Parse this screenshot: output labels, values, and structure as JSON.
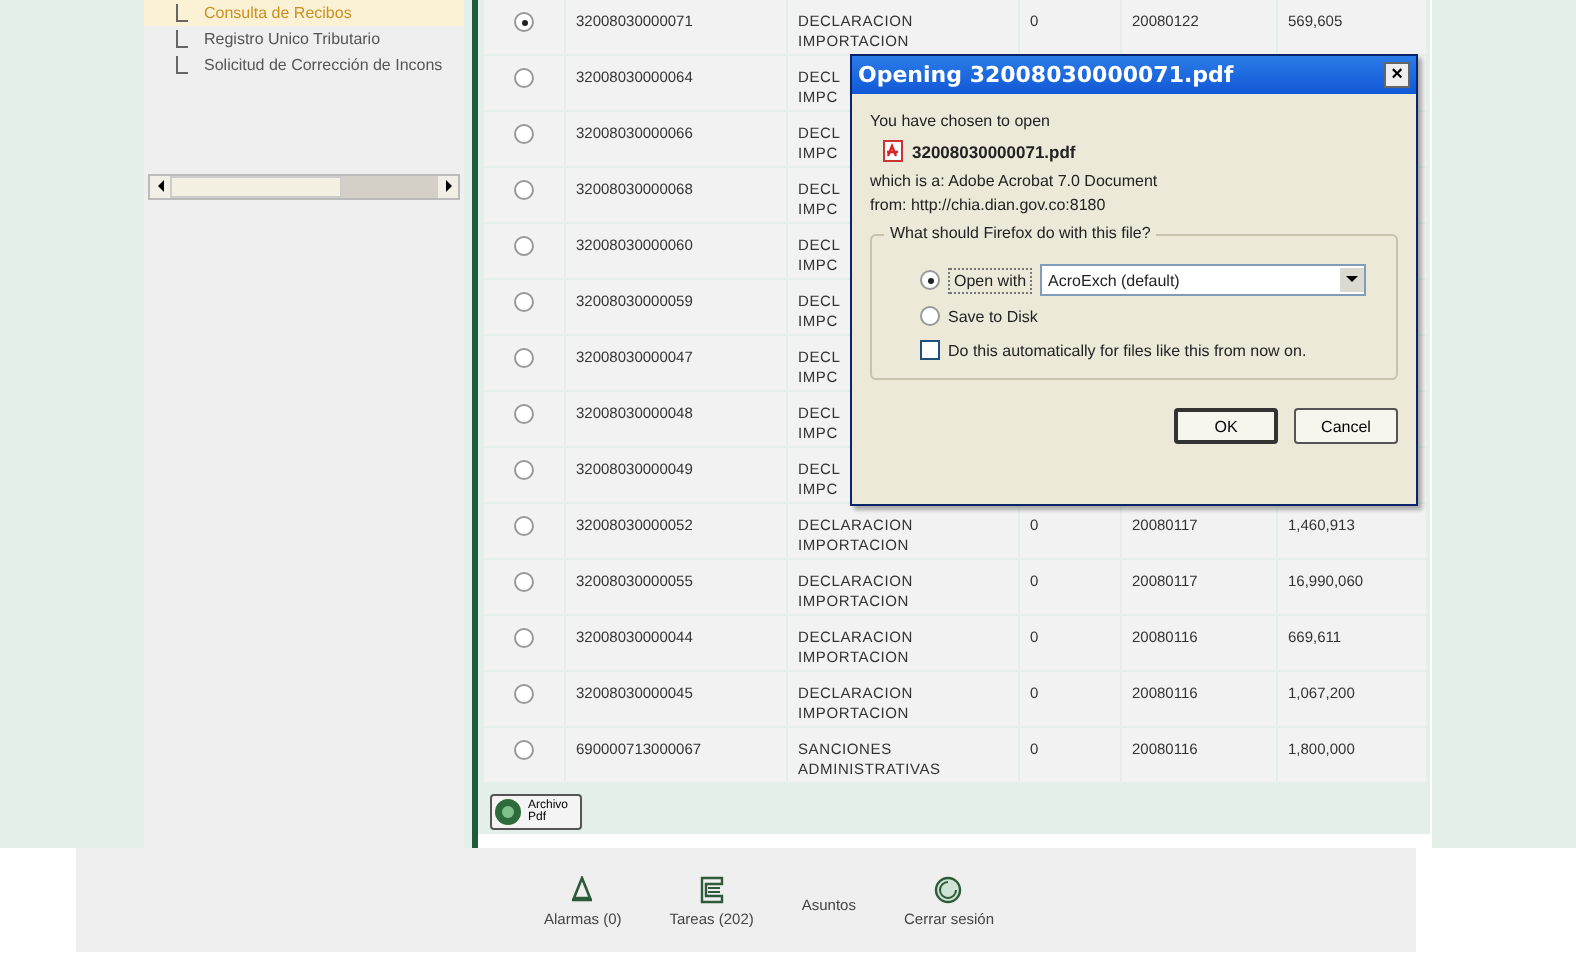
{
  "sidebar": {
    "items": [
      {
        "label": "Consulta de Recibos",
        "selected": true
      },
      {
        "label": "Registro Unico Tributario",
        "selected": false
      },
      {
        "label": "Solicitud de Corrección de Incons",
        "selected": false
      }
    ]
  },
  "table": {
    "rows": [
      {
        "selected": true,
        "number": "32008030000071",
        "type": [
          "DECLARACION",
          "IMPORTACION"
        ],
        "column_4": "0",
        "date": "20080122",
        "amount": "569,605"
      },
      {
        "selected": false,
        "number": "32008030000064",
        "type": [
          "DECL",
          "IMPC"
        ]
      },
      {
        "selected": false,
        "number": "32008030000066",
        "type": [
          "DECL",
          "IMPC"
        ]
      },
      {
        "selected": false,
        "number": "32008030000068",
        "type": [
          "DECL",
          "IMPC"
        ]
      },
      {
        "selected": false,
        "number": "32008030000060",
        "type": [
          "DECL",
          "IMPC"
        ]
      },
      {
        "selected": false,
        "number": "32008030000059",
        "type": [
          "DECL",
          "IMPC"
        ]
      },
      {
        "selected": false,
        "number": "32008030000047",
        "type": [
          "DECL",
          "IMPC"
        ]
      },
      {
        "selected": false,
        "number": "32008030000048",
        "type": [
          "DECL",
          "IMPC"
        ]
      },
      {
        "selected": false,
        "number": "32008030000049",
        "type": [
          "DECL",
          "IMPC"
        ]
      },
      {
        "selected": false,
        "number": "32008030000052",
        "type": [
          "DECLARACION",
          "IMPORTACION"
        ],
        "column_4": "0",
        "date": "20080117",
        "amount": "1,460,913"
      },
      {
        "selected": false,
        "number": "32008030000055",
        "type": [
          "DECLARACION",
          "IMPORTACION"
        ],
        "column_4": "0",
        "date": "20080117",
        "amount": "16,990,060"
      },
      {
        "selected": false,
        "number": "32008030000044",
        "type": [
          "DECLARACION",
          "IMPORTACION"
        ],
        "column_4": "0",
        "date": "20080116",
        "amount": "669,611"
      },
      {
        "selected": false,
        "number": "32008030000045",
        "type": [
          "DECLARACION",
          "IMPORTACION"
        ],
        "column_4": "0",
        "date": "20080116",
        "amount": "1,067,200"
      },
      {
        "selected": false,
        "number": "690000713000067",
        "type": [
          "SANCIONES",
          "ADMINISTRATIVAS"
        ],
        "column_4": "0",
        "date": "20080116",
        "amount": "1,800,000"
      }
    ]
  },
  "archive_button": {
    "label": [
      "Archivo",
      "Pdf"
    ]
  },
  "dialog": {
    "title": "Opening 32008030000071.pdf",
    "close": "×",
    "intro": "You have chosen to open",
    "file_name": "32008030000071.pdf",
    "file_type": "which is a:  Adobe Acrobat 7.0 Document",
    "source": "from:  http://chia.dian.gov.co:8180",
    "group_title": "What should Firefox do with this file?",
    "options": [
      {
        "label": "Open with",
        "selected": true
      },
      {
        "label": "Save to Disk",
        "selected": false
      }
    ],
    "application": "AcroExch (default)",
    "auto_checkbox": {
      "label": "Do this automatically for files like this from now on.",
      "checked": false
    },
    "buttons": [
      "OK",
      "Cancel"
    ]
  },
  "footer": {
    "items": [
      {
        "kind": "bell",
        "label": "Alarmas (0)"
      },
      {
        "kind": "scroll",
        "label": "Tareas (202)"
      },
      {
        "kind": "none",
        "label": "Asuntos"
      },
      {
        "kind": "globe",
        "label": "Cerrar sesión"
      }
    ]
  }
}
